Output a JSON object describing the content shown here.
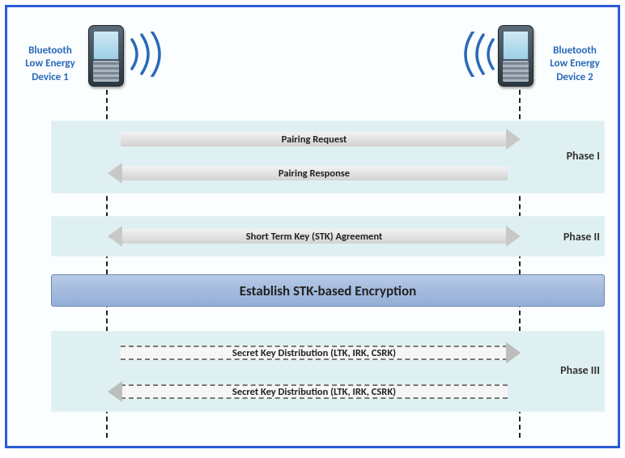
{
  "devices": {
    "left": "Bluetooth\nLow Energy\nDevice 1",
    "right": "Bluetooth\nLow Energy\nDevice 2"
  },
  "phases": {
    "p1": "Phase I",
    "p2": "Phase II",
    "p3": "Phase III"
  },
  "arrows": {
    "pairing_request": "Pairing Request",
    "pairing_response": "Pairing Response",
    "stk_agreement": "Short Term Key (STK) Agreement",
    "secret_dist_1": "Secret Key Distribution (LTK, IRK, CSRK)",
    "secret_dist_2": "Secret Key Distribution (LTK, IRK, CSRK)"
  },
  "establish": "Establish STK-based Encryption"
}
